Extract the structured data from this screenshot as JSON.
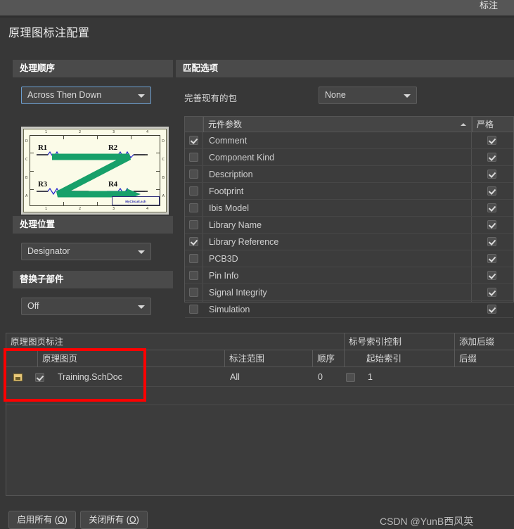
{
  "window": {
    "tab_label": "标注",
    "dialog_title": "原理图标注配置"
  },
  "left_panel": {
    "process_order": {
      "header": "处理顺序",
      "value": "Across Then Down"
    },
    "preview": {
      "resistors": [
        "R1",
        "R2",
        "R3",
        "R4"
      ],
      "column_labels": [
        "1",
        "2",
        "3",
        "4"
      ],
      "row_labels": [
        "D",
        "C",
        "B",
        "A"
      ],
      "title_block": "MyCircuit.sch"
    },
    "process_location": {
      "header": "处理位置",
      "value": "Designator"
    },
    "replace_subpart": {
      "header": "替换子部件",
      "value": "Off"
    }
  },
  "right_panel": {
    "match_options": {
      "header": "匹配选项",
      "existing_packages_label": "完善现有的包",
      "existing_packages_value": "None"
    },
    "param_table": {
      "col_parameter": "元件参数",
      "col_strict": "严格",
      "sort_icon": "sort-ascending-icon",
      "rows": [
        {
          "name": "Comment",
          "enabled": true,
          "strict": true
        },
        {
          "name": "Component Kind",
          "enabled": false,
          "strict": true
        },
        {
          "name": "Description",
          "enabled": false,
          "strict": true
        },
        {
          "name": "Footprint",
          "enabled": false,
          "strict": true
        },
        {
          "name": "Ibis Model",
          "enabled": false,
          "strict": true
        },
        {
          "name": "Library Name",
          "enabled": false,
          "strict": true
        },
        {
          "name": "Library Reference",
          "enabled": true,
          "strict": true
        },
        {
          "name": "PCB3D",
          "enabled": false,
          "strict": true
        },
        {
          "name": "Pin Info",
          "enabled": false,
          "strict": true
        },
        {
          "name": "Signal Integrity",
          "enabled": false,
          "strict": true
        },
        {
          "name": "Simulation",
          "enabled": false,
          "strict": true
        }
      ]
    }
  },
  "sheet_table": {
    "group_headers": {
      "sheets": "原理图页标注",
      "index_control": "标号索引控制",
      "add_suffix": "添加后缀"
    },
    "columns": {
      "sheet": "原理图页",
      "scope": "标注范围",
      "order": "顺序",
      "start_index": "起始索引",
      "suffix": "后缀"
    },
    "rows": [
      {
        "icon": "schematic-document-icon",
        "enabled": true,
        "sheet": "Training.SchDoc",
        "scope": "All",
        "order": "0",
        "index_enabled": false,
        "start_index": "1",
        "suffix": ""
      }
    ]
  },
  "footer": {
    "enable_all": {
      "text": "启用所有 (",
      "accel": "O",
      "text_end": ")"
    },
    "disable_all": {
      "text": "关闭所有 (",
      "accel": "O",
      "text_end": ")"
    }
  },
  "watermark": "CSDN @YunB西风英",
  "colors": {
    "window_bg": "#373737",
    "section_header": "#4a4a4a",
    "annotation_red": "#ff0000",
    "arrow_green": "#17a06a",
    "schematic_paper": "#fbfbe8"
  }
}
